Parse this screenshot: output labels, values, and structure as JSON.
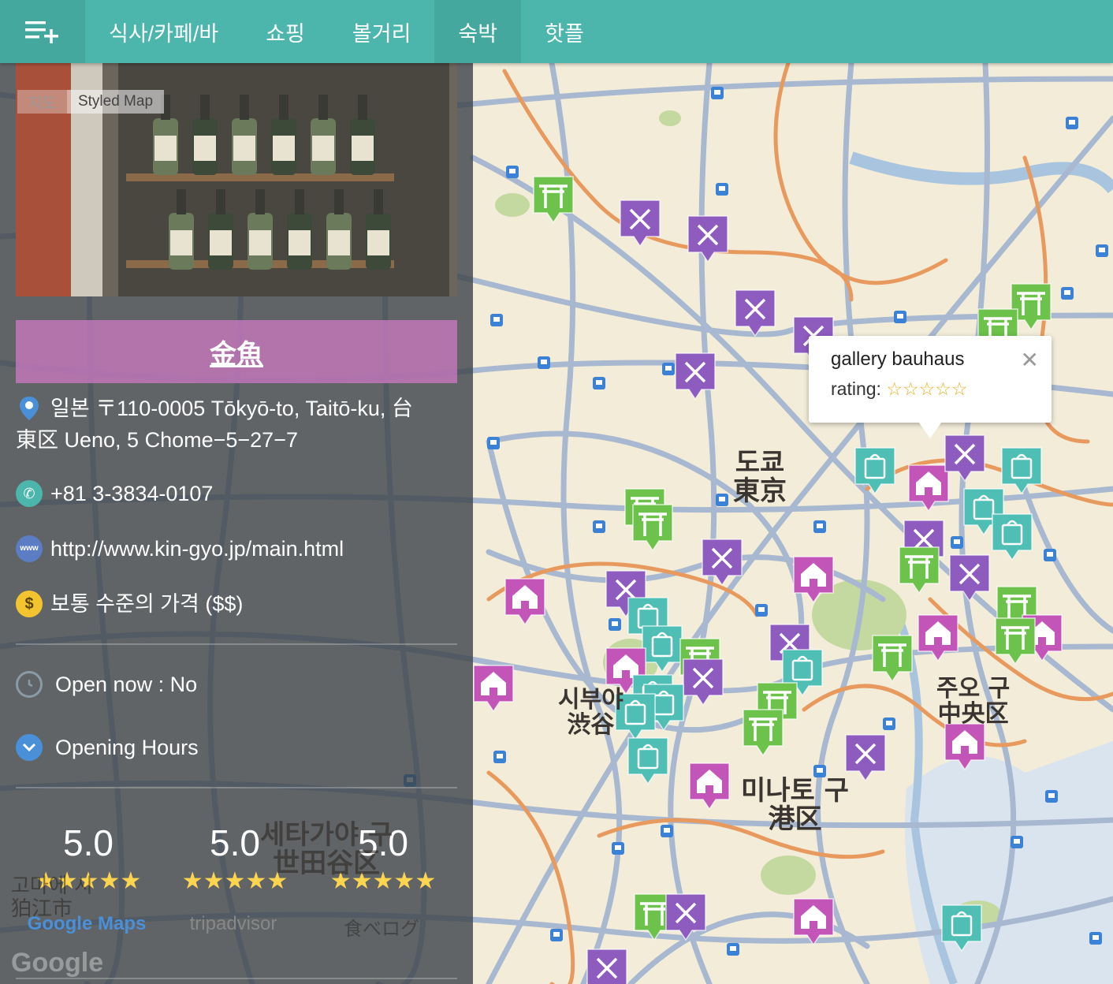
{
  "nav": {
    "menu_icon": "playlist-add-icon",
    "tabs": [
      {
        "label": "식사/카페/바"
      },
      {
        "label": "쇼핑"
      },
      {
        "label": "볼거리"
      },
      {
        "label": "숙박"
      },
      {
        "label": "핫플"
      }
    ],
    "active_tab": 3
  },
  "map": {
    "map_type_buttons": [
      "지도",
      "Styled Map"
    ],
    "active_map_type": "Styled Map",
    "labels": {
      "tokyo": "도쿄\n東京",
      "chuo": "주오 구\n中央区",
      "minato": "미나토 구\n港区",
      "shibuya": "시부야\n渋谷",
      "setagaya": "세타가야 구\n世田谷区",
      "komae": "고마에 시\n狛江市",
      "attribution": "Google"
    },
    "colors": {
      "land": "#f2ecd9",
      "road": "#a8b8d0",
      "highway": "#e89a5e",
      "park": "#b6cf8f",
      "water": "#a8c4de",
      "restaurant_marker": "#8e5bbf",
      "shopping_marker": "#4fbfb5",
      "sights_marker": "#6cc24a",
      "lodging_marker": "#c354b8"
    }
  },
  "panel": {
    "place_name": "金魚",
    "address": "일본 〒110-0005 Tōkyō-to, Taitō-ku, 台東区 Ueno, 5 Chome−5−27−7",
    "phone": "+81 3-3834-0107",
    "website": "http://www.kin-gyo.jp/main.html",
    "price": "보통 수준의 가격 ($$)",
    "open_now": "Open now : No",
    "opening_hours_label": "Opening Hours",
    "ratings": [
      {
        "value": "5.0",
        "stars": "★★★★★",
        "source": "Google Maps",
        "rating": 5
      },
      {
        "value": "5.0",
        "stars": "★★★★★",
        "source": "tripadvisor",
        "rating": 5
      },
      {
        "value": "5.0",
        "stars": "★★★★★",
        "source": "食べログ",
        "rating": 5
      }
    ],
    "icons": {
      "address": "location-pin-icon",
      "phone": "phone-icon",
      "website": "globe-icon",
      "price": "dollar-icon",
      "open": "clock-icon",
      "hours": "chevron-down-icon"
    }
  },
  "popup": {
    "title": "gallery bauhaus",
    "rating_label": "rating:",
    "rating_stars": "☆☆☆☆☆",
    "close": "✕"
  }
}
